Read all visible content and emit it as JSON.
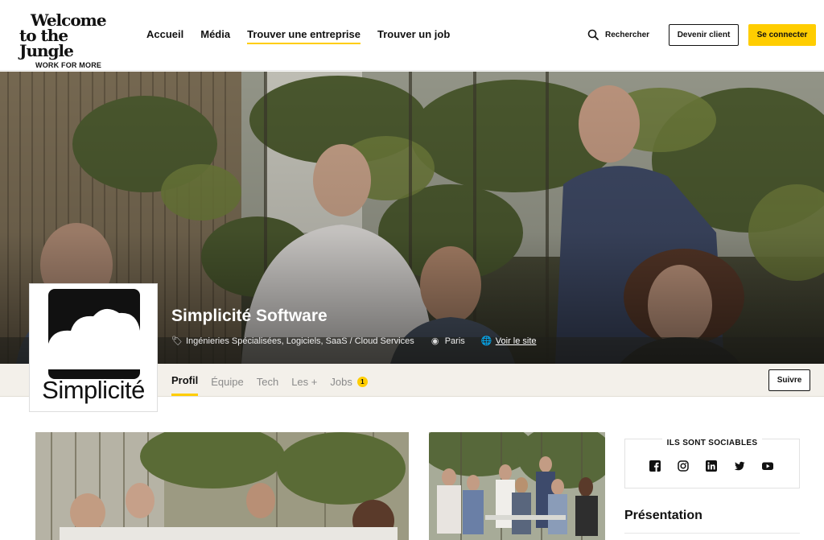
{
  "header": {
    "logo": {
      "line1": "Welcome",
      "line2": "to the Jungle",
      "tagline": "WORK FOR MORE"
    },
    "nav": [
      {
        "label": "Accueil"
      },
      {
        "label": "Média"
      },
      {
        "label": "Trouver une entreprise",
        "active": true
      },
      {
        "label": "Trouver un job"
      }
    ],
    "search_label": "Rechercher",
    "client_button": "Devenir client",
    "login_button": "Se connecter",
    "accent_color": "#ffcd00"
  },
  "company": {
    "name": "Simplicité Software",
    "sectors": "Ingénieries Spécialisées, Logiciels, SaaS / Cloud Services",
    "location": "Paris",
    "website_link": "Voir le site",
    "logo_text": "Simplicité"
  },
  "tabs": [
    {
      "label": "Profil",
      "active": true
    },
    {
      "label": "Équipe"
    },
    {
      "label": "Tech"
    },
    {
      "label": "Les +"
    },
    {
      "label": "Jobs",
      "badge": "1"
    }
  ],
  "follow_button": "Suivre",
  "social": {
    "title": "ILS SONT SOCIABLES",
    "icons": [
      "facebook-icon",
      "instagram-icon",
      "linkedin-icon",
      "twitter-icon",
      "youtube-icon"
    ]
  },
  "presentation_title": "Présentation"
}
